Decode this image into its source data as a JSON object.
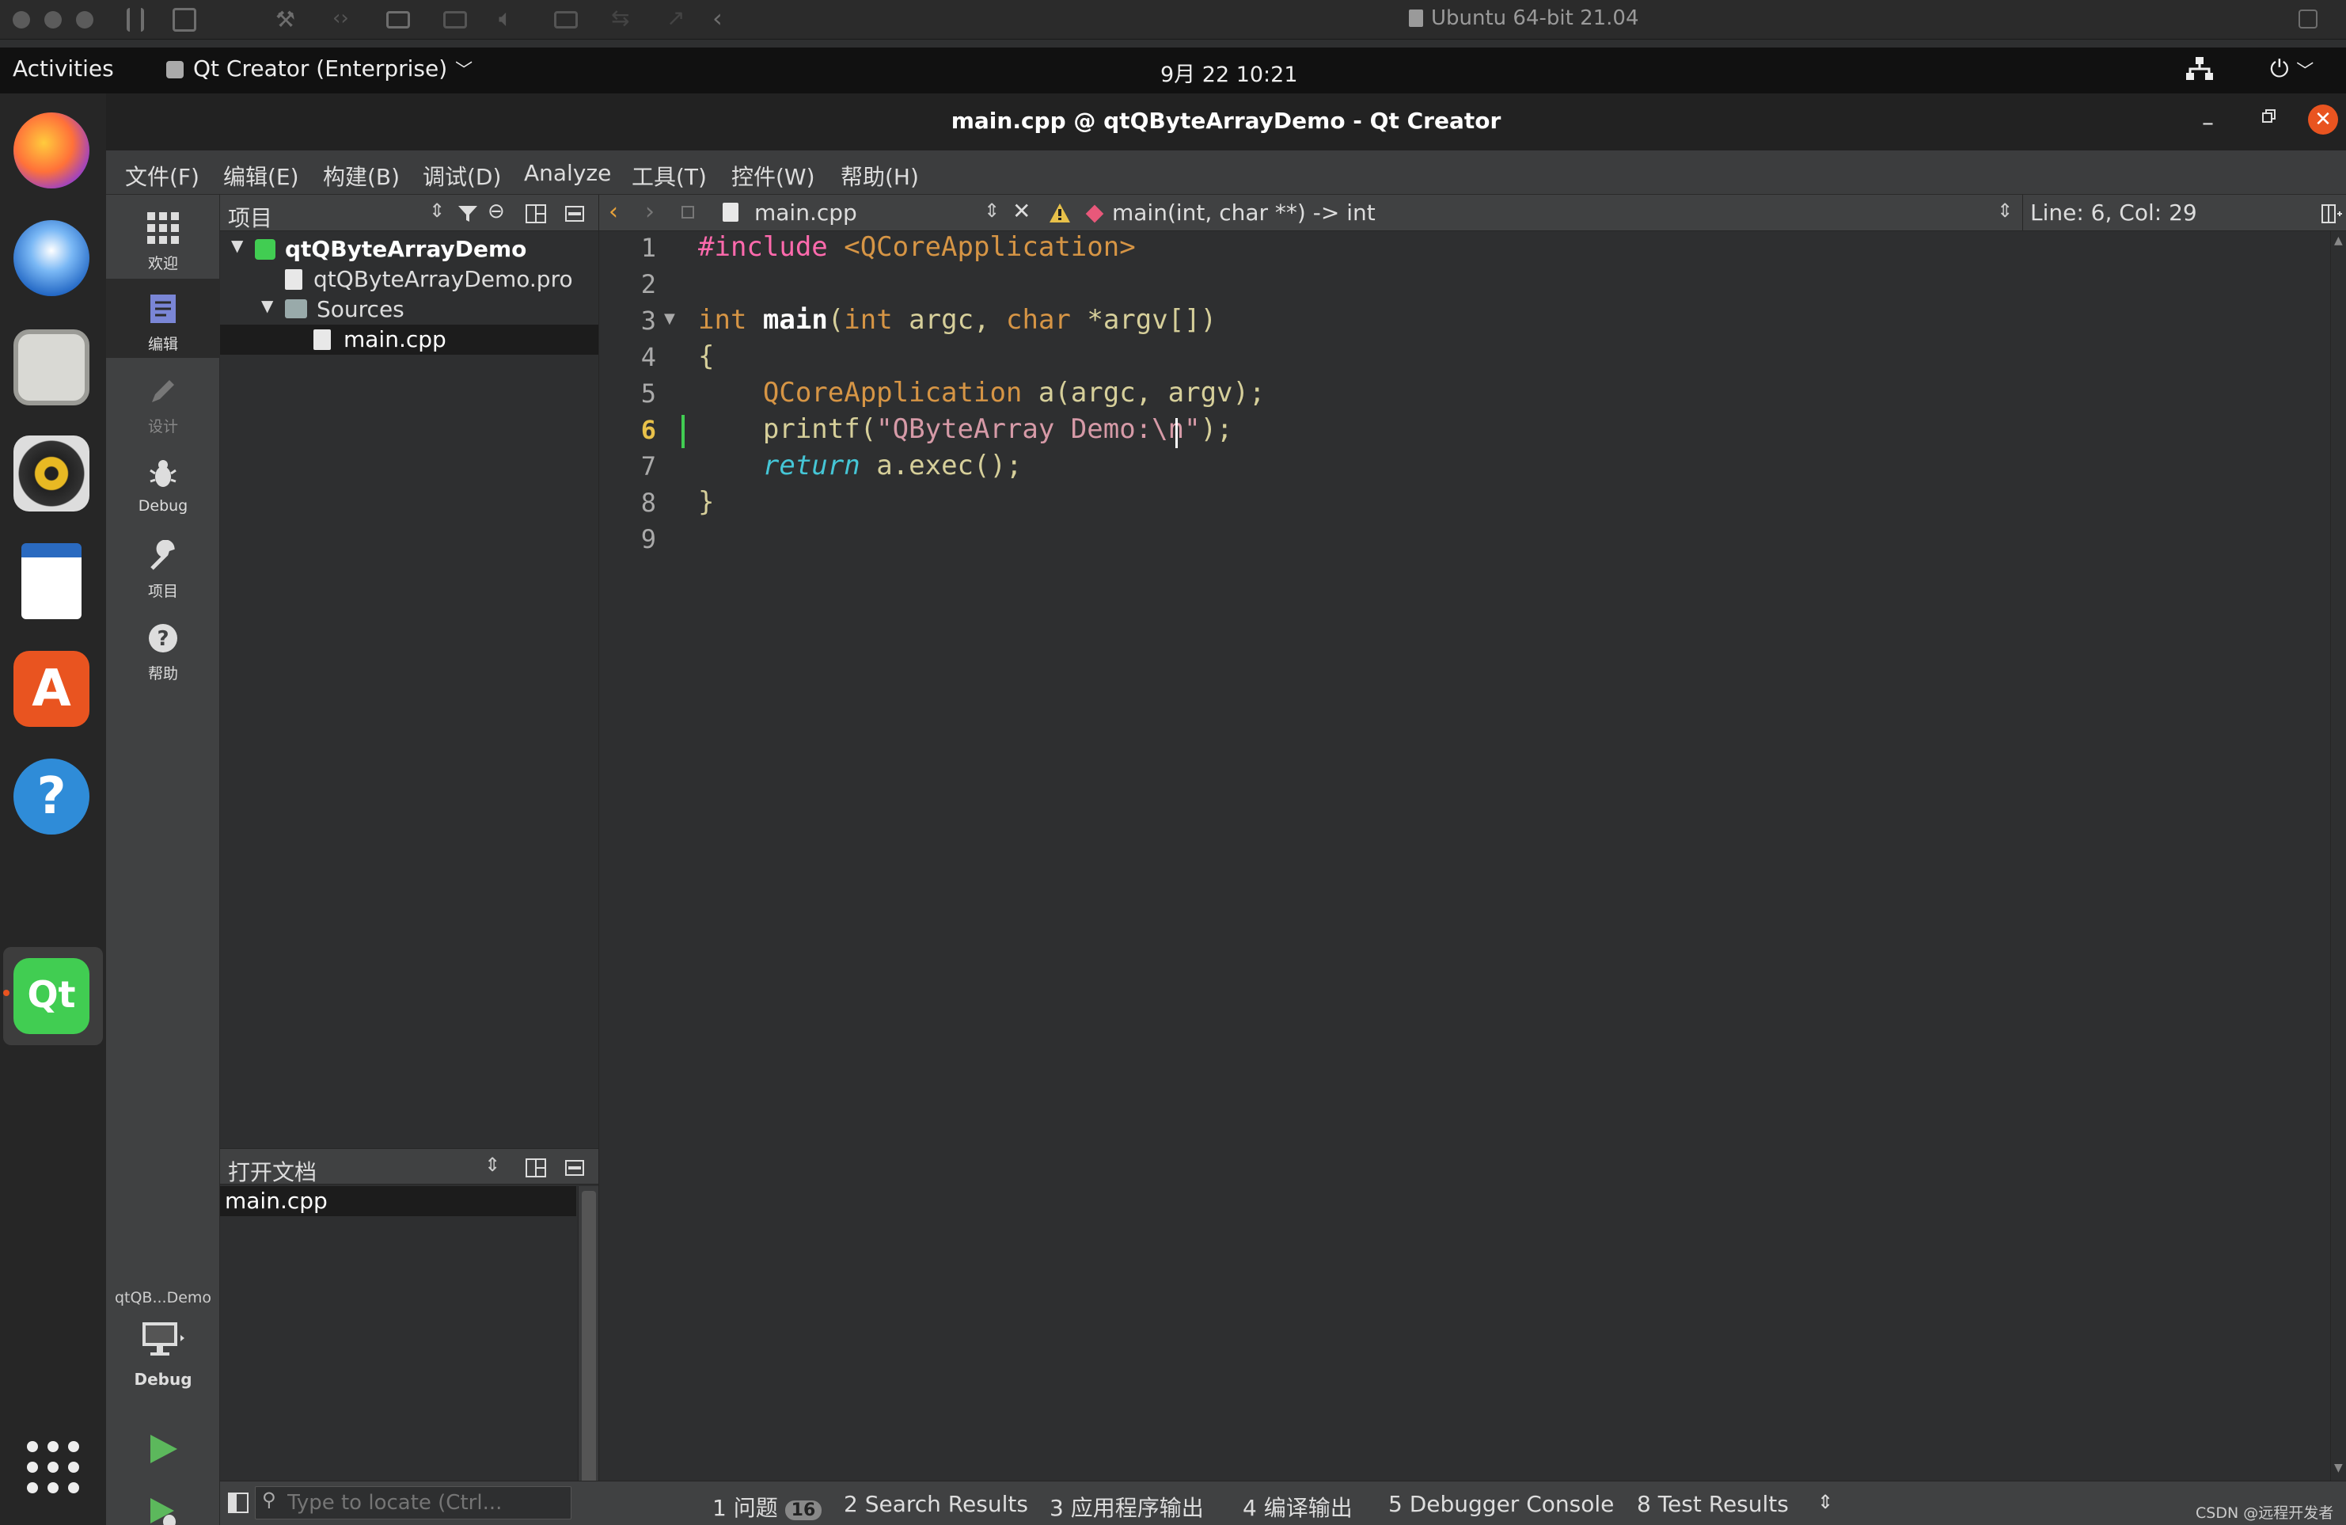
{
  "vm": {
    "title": "Ubuntu 64-bit 21.04"
  },
  "gnome": {
    "activities": "Activities",
    "app_menu": "Qt Creator (Enterprise)",
    "clock": "9月 22  10:21"
  },
  "window": {
    "title": "main.cpp @ qtQByteArrayDemo - Qt Creator"
  },
  "menu": [
    "文件(F)",
    "编辑(E)",
    "构建(B)",
    "调试(D)",
    "Analyze",
    "工具(T)",
    "控件(W)",
    "帮助(H)"
  ],
  "modes": {
    "welcome": "欢迎",
    "edit": "编辑",
    "design": "设计",
    "debug": "Debug",
    "projects": "项目",
    "help": "帮助"
  },
  "kit": {
    "project": "qtQB...Demo",
    "build": "Debug"
  },
  "projects_panel": {
    "title": "项目",
    "tree": {
      "root": "qtQByteArrayDemo",
      "pro": "qtQByteArrayDemo.pro",
      "sources": "Sources",
      "main": "main.cpp"
    }
  },
  "open_docs": {
    "title": "打开文档",
    "items": [
      "main.cpp"
    ]
  },
  "editor": {
    "file": "main.cpp",
    "symbol": "main(int, char **) -> int",
    "position": "Line: 6, Col: 29",
    "line_numbers": [
      "1",
      "2",
      "3",
      "4",
      "5",
      "6",
      "7",
      "8",
      "9"
    ],
    "code": {
      "l1a": "#include",
      "l1b": " <QCoreApplication>",
      "l3a": "int",
      "l3b": " ",
      "l3c": "main",
      "l3d": "(",
      "l3e": "int",
      "l3f": " argc, ",
      "l3g": "char",
      "l3h": " *argv[])",
      "l4": "{",
      "l5a": "    ",
      "l5b": "QCoreApplication",
      "l5c": " a(argc, argv);",
      "l6a": "    printf(",
      "l6b": "\"QByteArray Demo:\\n\"",
      "l6c": ");",
      "l7a": "    ",
      "l7b": "return",
      "l7c": " a.exec();",
      "l8": "}"
    }
  },
  "status": {
    "locate_placeholder": "Type to locate (Ctrl...",
    "issues_num": "1",
    "issues_label": "问题",
    "issues_count": "16",
    "search": "2  Search Results",
    "app_output": "3  应用程序输出",
    "compile": "4  编译输出",
    "debugger": "5  Debugger Console",
    "tests": "8  Test Results"
  },
  "watermark": "CSDN @远程开发者",
  "colors": {
    "accent_close": "#e95420",
    "qt_green": "#41cd52"
  }
}
